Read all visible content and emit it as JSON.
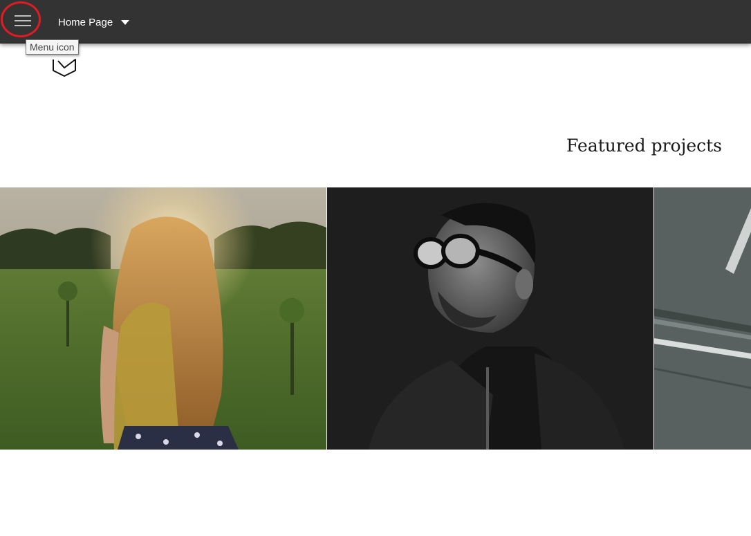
{
  "header": {
    "page_selector_label": "Home Page",
    "menu_icon": "hamburger-menu-icon",
    "caret_icon": "caret-down-icon"
  },
  "tooltip": {
    "text": "Menu icon"
  },
  "brand": {
    "logo_icon": "envelope-logo-icon"
  },
  "featured": {
    "title": "Featured projects",
    "projects": [
      {
        "image": "woman-in-sunlit-field"
      },
      {
        "image": "man-with-goggles-portrait"
      },
      {
        "image": "asphalt-road-markings"
      }
    ]
  },
  "colors": {
    "topbar": "#333333",
    "highlight_ring": "#e01b24",
    "text_light": "#ffffff"
  }
}
